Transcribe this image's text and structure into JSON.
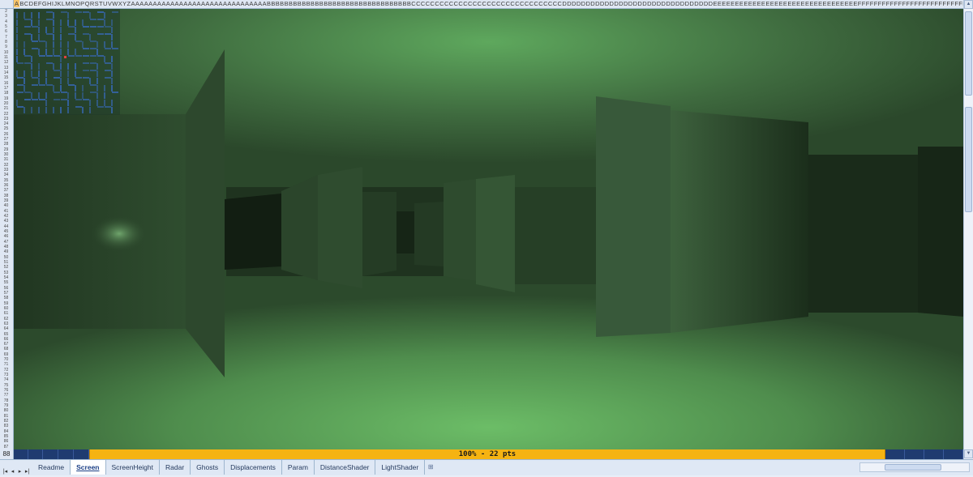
{
  "column_header": {
    "active_column": "A",
    "labels": "BCDEFGHIJKLMNOPQRSTUVWXYZAAAAAAAAAAAAAAAAAAAAAAAAAAAAAAABBBBBBBBBBBBBBBBBBBBBBBBBBBBBBBBBCCCCCCCCCCCCCCCCCCCCCCCCCCCCCCCCDDDDDDDDDDDDDDDDDDDDDDDDDDDDDDDDEEEEEEEEEEEEEEEEEEEEEEEEEEEEEEEEEFFFFFFFFFFFFFFFFFFFFFFFFFFFFFFFGGGGGG"
  },
  "row_header": {
    "first_row": 2,
    "last_row": 87,
    "status_row_label": "88"
  },
  "status": {
    "text": "100%   -   22 pts",
    "bar_color": "#f5b312",
    "bar_background": "#1f3b70"
  },
  "game": {
    "fog_color": "#6db86a",
    "wall_color": "#2f4a2f",
    "floor_color": "#65b060",
    "radar_color": "#3a6fd0"
  },
  "sheet_tabs": {
    "nav_icons": [
      "first-sheet-icon",
      "prev-sheet-icon",
      "next-sheet-icon",
      "last-sheet-icon"
    ],
    "tabs": [
      {
        "label": "Readme",
        "active": false
      },
      {
        "label": "Screen",
        "active": true
      },
      {
        "label": "ScreenHeight",
        "active": false
      },
      {
        "label": "Radar",
        "active": false
      },
      {
        "label": "Ghosts",
        "active": false
      },
      {
        "label": "Displacements",
        "active": false
      },
      {
        "label": "Param",
        "active": false
      },
      {
        "label": "DistanceShader",
        "active": false
      },
      {
        "label": "LightShader",
        "active": false
      }
    ]
  }
}
